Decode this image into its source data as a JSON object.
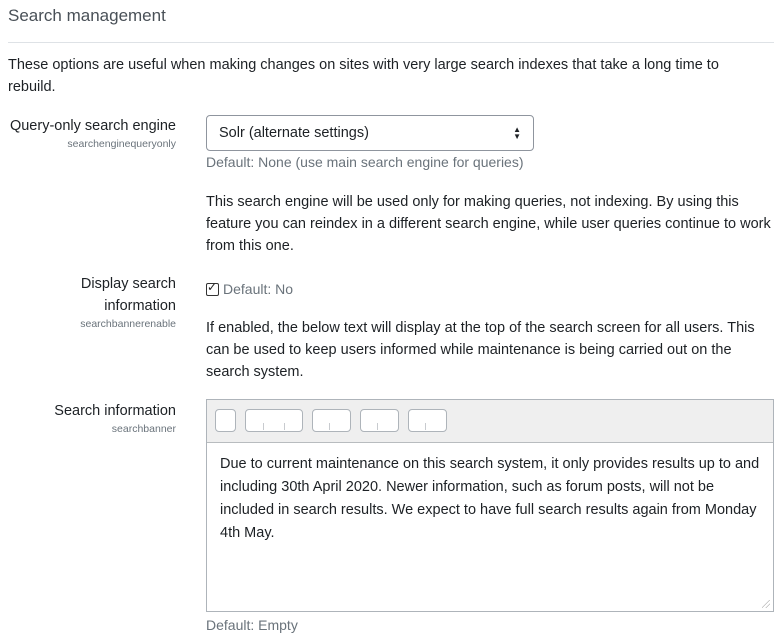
{
  "section": {
    "title": "Search management",
    "intro": "These options are useful when making changes on sites with very large search indexes that take a long time to rebuild."
  },
  "query_only": {
    "label": "Query-only search engine",
    "setting_name": "searchenginequeryonly",
    "selected": "Solr (alternate settings)",
    "default": "Default: None (use main search engine for queries)",
    "description": "This search engine will be used only for making queries, not indexing. By using this feature you can reindex in a different search engine, while user queries continue to work from this one."
  },
  "display_info": {
    "label_line1": "Display search",
    "label_line2": "information",
    "setting_name": "searchbannerenable",
    "checked": true,
    "checkbox_label": "Default: No",
    "description": "If enabled, the below text will display at the top of the search screen for all users. This can be used to keep users informed while maintenance is being carried out on the search system."
  },
  "search_info": {
    "label": "Search information",
    "setting_name": "searchbanner",
    "content": "Due to current maintenance on this search system, it only provides results up to and including 30th April 2020. Newer information, such as forum posts, will not be included in search results. We expect to have full search results again from Monday 4th May.",
    "default": "Default: Empty"
  }
}
